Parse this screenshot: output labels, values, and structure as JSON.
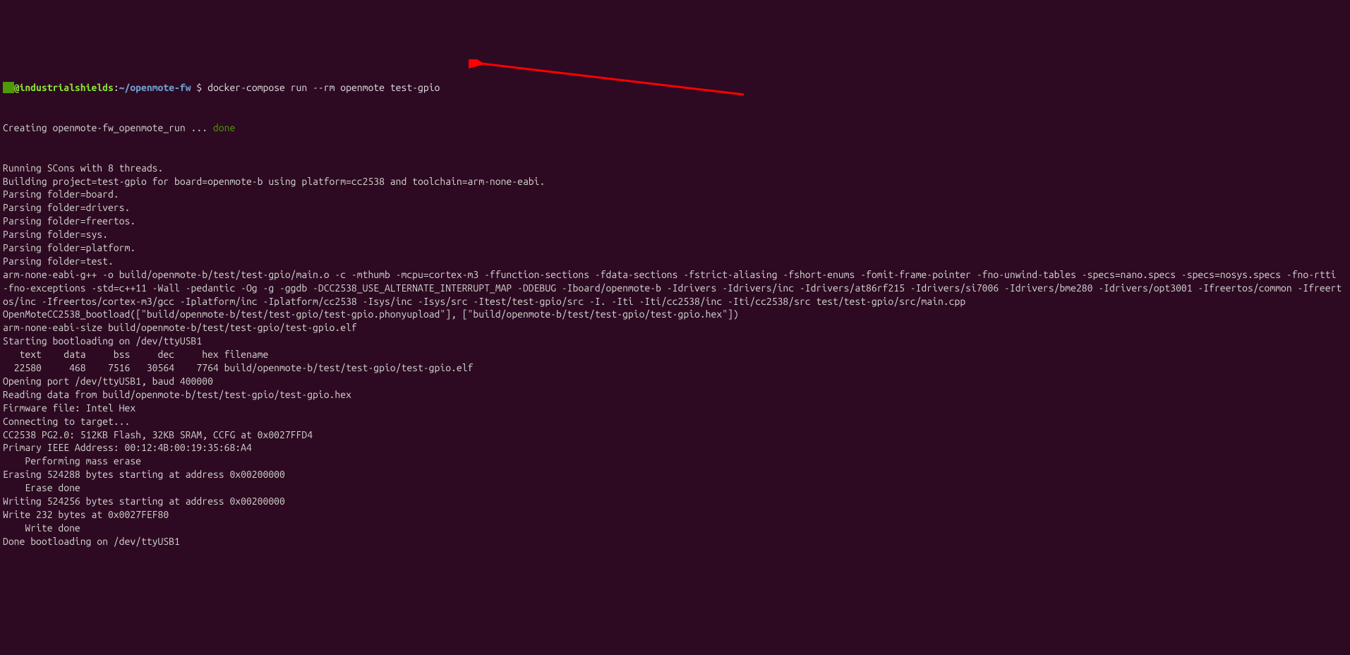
{
  "prompt": {
    "user_host": "@industrialshields",
    "separator": ":",
    "path": "~/openmote-fw",
    "symbol": "$",
    "command": "docker-compose run --rm openmote test-gpio"
  },
  "creating_line": {
    "prefix": "Creating openmote-fw_openmote_run ... ",
    "status": "done"
  },
  "lines": [
    "Running SCons with 8 threads.",
    "Building project=test-gpio for board=openmote-b using platform=cc2538 and toolchain=arm-none-eabi.",
    "Parsing folder=board.",
    "Parsing folder=drivers.",
    "Parsing folder=freertos.",
    "Parsing folder=sys.",
    "Parsing folder=platform.",
    "Parsing folder=test.",
    "arm-none-eabi-g++ -o build/openmote-b/test/test-gpio/main.o -c -mthumb -mcpu=cortex-m3 -ffunction-sections -fdata-sections -fstrict-aliasing -fshort-enums -fomit-frame-pointer -fno-unwind-tables -specs=nano.specs -specs=nosys.specs -fno-rtti -fno-exceptions -std=c++11 -Wall -pedantic -Og -g -ggdb -DCC2538_USE_ALTERNATE_INTERRUPT_MAP -DDEBUG -Iboard/openmote-b -Idrivers -Idrivers/inc -Idrivers/at86rf215 -Idrivers/si7006 -Idrivers/bme280 -Idrivers/opt3001 -Ifreertos/common -Ifreertos/inc -Ifreertos/cortex-m3/gcc -Iplatform/inc -Iplatform/cc2538 -Isys/inc -Isys/src -Itest/test-gpio/src -I. -Iti -Iti/cc2538/inc -Iti/cc2538/src test/test-gpio/src/main.cpp",
    "OpenMoteCC2538_bootload([\"build/openmote-b/test/test-gpio/test-gpio.phonyupload\"], [\"build/openmote-b/test/test-gpio/test-gpio.hex\"])",
    "arm-none-eabi-size build/openmote-b/test/test-gpio/test-gpio.elf",
    "Starting bootloading on /dev/ttyUSB1",
    "   text    data     bss     dec     hex filename",
    "  22580     468    7516   30564    7764 build/openmote-b/test/test-gpio/test-gpio.elf",
    "Opening port /dev/ttyUSB1, baud 400000",
    "Reading data from build/openmote-b/test/test-gpio/test-gpio.hex",
    "Firmware file: Intel Hex",
    "Connecting to target...",
    "CC2538 PG2.0: 512KB Flash, 32KB SRAM, CCFG at 0x0027FFD4",
    "Primary IEEE Address: 00:12:4B:00:19:35:68:A4",
    "    Performing mass erase",
    "Erasing 524288 bytes starting at address 0x00200000",
    "    Erase done",
    "Writing 524256 bytes starting at address 0x00200000",
    "Write 232 bytes at 0x0027FEF80",
    "    Write done",
    "Done bootloading on /dev/ttyUSB1"
  ],
  "annotation": {
    "color": "#ff0000"
  }
}
